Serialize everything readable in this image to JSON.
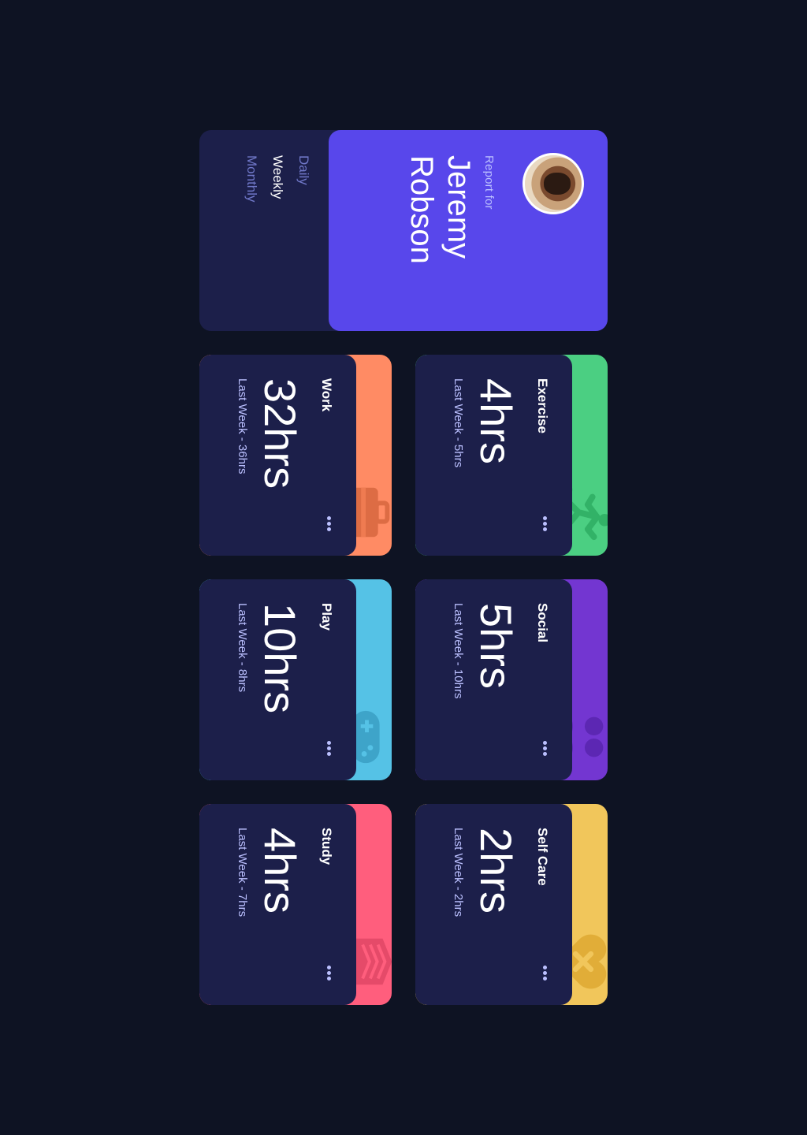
{
  "profile": {
    "report_label": "Report for",
    "name": "Jeremy Robson",
    "periods": [
      "Daily",
      "Weekly",
      "Monthly"
    ],
    "active_period": "Weekly",
    "accent": "#5847eb"
  },
  "activities": [
    {
      "title": "Work",
      "current": "32hrs",
      "previous": "Last Week - 36hrs",
      "color": "#ff8b64",
      "icon": "briefcase-icon"
    },
    {
      "title": "Play",
      "current": "10hrs",
      "previous": "Last Week - 8hrs",
      "color": "#55c2e6",
      "icon": "gamepad-icon"
    },
    {
      "title": "Study",
      "current": "4hrs",
      "previous": "Last Week - 7hrs",
      "color": "#ff5e7d",
      "icon": "book-icon"
    },
    {
      "title": "Exercise",
      "current": "4hrs",
      "previous": "Last Week - 5hrs",
      "color": "#4bcf82",
      "icon": "running-icon"
    },
    {
      "title": "Social",
      "current": "5hrs",
      "previous": "Last Week - 10hrs",
      "color": "#7336d1",
      "icon": "people-icon"
    },
    {
      "title": "Self Care",
      "current": "2hrs",
      "previous": "Last Week - 2hrs",
      "color": "#f1c65b",
      "icon": "heart-icon"
    }
  ],
  "colors": {
    "background": "#0e1323",
    "card": "#1c1f4a",
    "muted_text": "#bbc0ff",
    "inactive_tab": "#7078c9"
  }
}
